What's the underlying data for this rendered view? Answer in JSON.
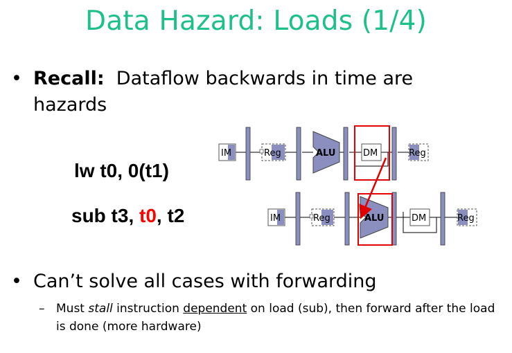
{
  "slide": {
    "title": "Data Hazard: Loads (1/4)",
    "bullets": [
      {
        "marker": "•",
        "bold": "Recall:",
        "text": "  Dataflow backwards in time are hazards"
      },
      {
        "marker": "•",
        "text": "Can’t solve all cases with forwarding"
      }
    ],
    "sub_bullet": {
      "marker": "–",
      "part1": "Must ",
      "italic": "stall",
      "part2": " instruction ",
      "underline": "dependent",
      "part3": " on load (sub), then forward after the load is done (more hardware)"
    },
    "instructions": {
      "lw": "lw t0, 0(t1)",
      "sub_prefix": "sub t3, ",
      "sub_reg": "t0",
      "sub_suffix": ", t2"
    },
    "pipeline": {
      "stages": [
        "IM",
        "Reg",
        "ALU",
        "DM",
        "Reg"
      ],
      "colors": {
        "stage_fill": "#8a8fbf",
        "highlight": "#e00000",
        "box_border": "#555555"
      }
    }
  }
}
